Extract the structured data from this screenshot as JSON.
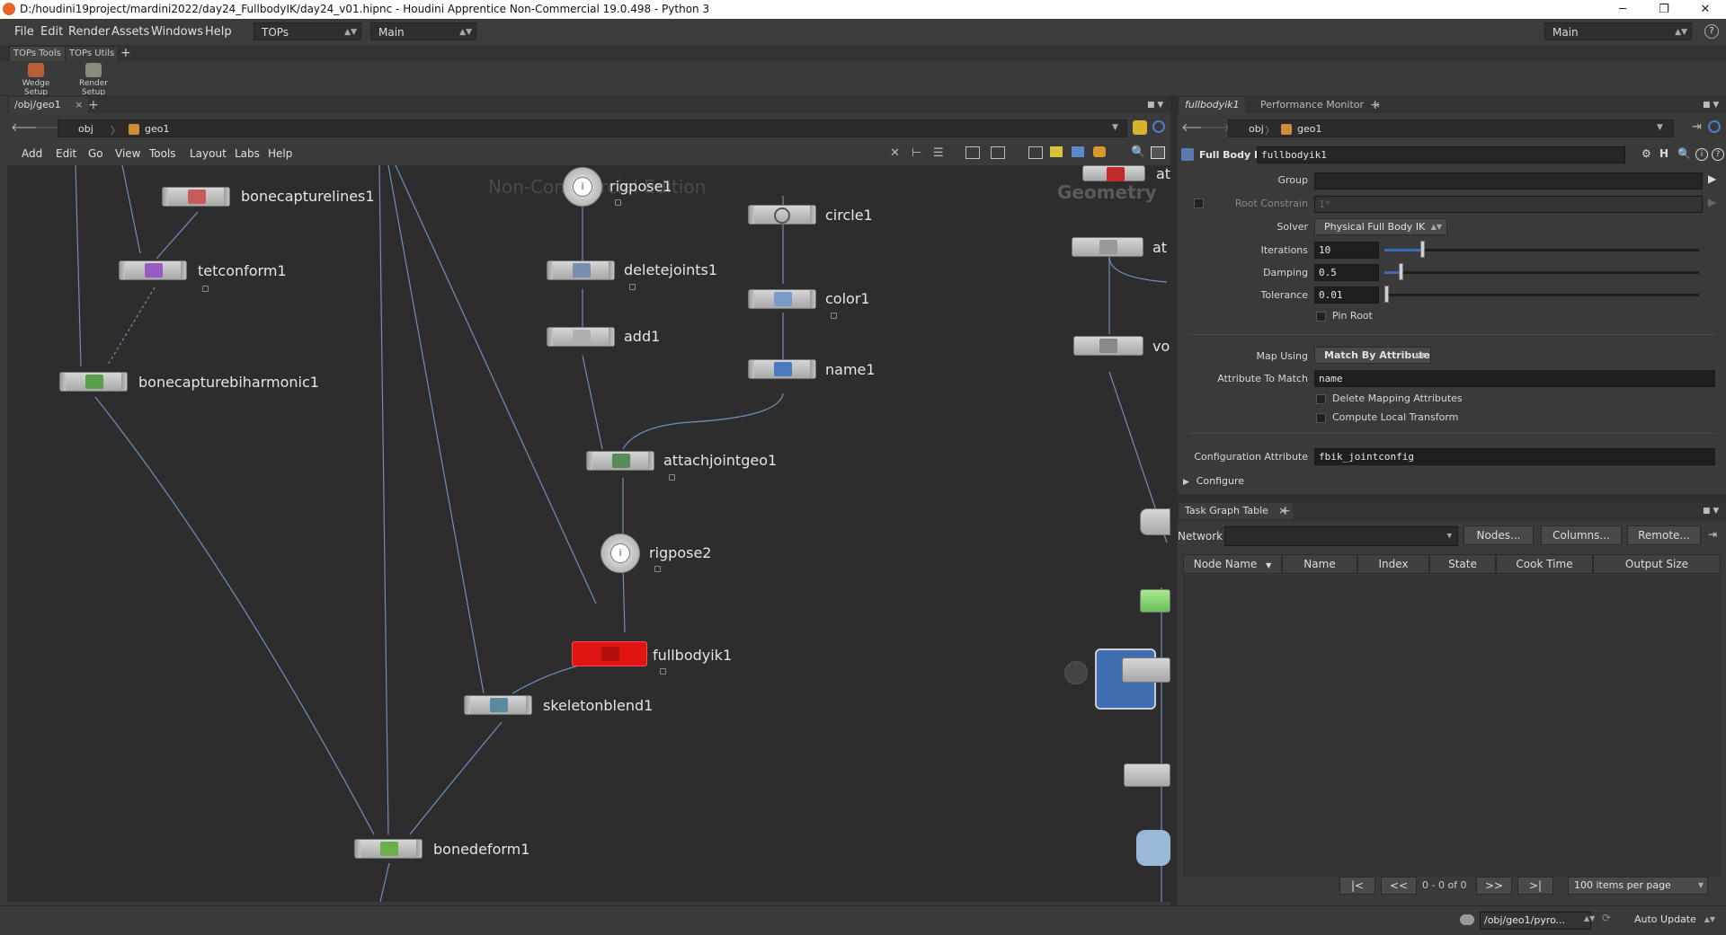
{
  "window": {
    "title": "D:/houdini19project/mardini2022/day24_FullbodyIK/day24_v01.hipnc - Houdini Apprentice Non-Commercial 19.0.498 - Python 3",
    "minimize": "─",
    "maximize": "❐",
    "close": "✕"
  },
  "menubar": {
    "items": [
      "File",
      "Edit",
      "Render",
      "Assets",
      "Windows",
      "Help"
    ],
    "desktop_select": "TOPs",
    "context_select": "Main",
    "right_select": "Main",
    "help_icon": "?"
  },
  "shelf": {
    "tabs": [
      "TOPs Tools",
      "TOPs Utils"
    ],
    "add": "+",
    "tools": [
      "Wedge Setup",
      "Render Setup"
    ]
  },
  "left_pane": {
    "tab": "/obj/geo1",
    "tab_close": "×",
    "add": "+",
    "path": [
      "obj",
      "geo1"
    ],
    "menu": [
      "Add",
      "Edit",
      "Go",
      "View",
      "Tools",
      "Layout",
      "Labs",
      "Help"
    ]
  },
  "network": {
    "watermark_left": "Non-Commercial Edition",
    "watermark_right": "Geometry",
    "nodes": [
      {
        "name": "bonecapturelines1"
      },
      {
        "name": "tetconform1"
      },
      {
        "name": "bonecapturebiharmonic1"
      },
      {
        "name": "rigpose1"
      },
      {
        "name": "deletejoints1"
      },
      {
        "name": "add1"
      },
      {
        "name": "circle1"
      },
      {
        "name": "color1"
      },
      {
        "name": "name1"
      },
      {
        "name": "attachjointgeo1"
      },
      {
        "name": "rigpose2"
      },
      {
        "name": "fullbodyik1"
      },
      {
        "name": "skeletonblend1"
      },
      {
        "name": "bonedeform1"
      }
    ],
    "partial_labels": [
      "at",
      "at",
      "vo"
    ]
  },
  "right_pane": {
    "tabs": [
      "fullbodyik1",
      "Performance Monitor"
    ],
    "tab_close": "×",
    "add": "+",
    "path": [
      "obj",
      "geo1"
    ],
    "node_type": "Full Body IK",
    "node_name": "fullbodyik1"
  },
  "params": {
    "group": {
      "label": "Group",
      "value": ""
    },
    "root_constrain": {
      "label": "Root Constrain",
      "value": "1*"
    },
    "solver": {
      "label": "Solver",
      "value": "Physical Full Body IK"
    },
    "iterations": {
      "label": "Iterations",
      "value": "10",
      "level": 0.12
    },
    "damping": {
      "label": "Damping",
      "value": "0.5",
      "level": 0.05
    },
    "tolerance": {
      "label": "Tolerance",
      "value": "0.01",
      "level": 0.0
    },
    "pin_root": "Pin Root",
    "map_using": {
      "label": "Map Using",
      "value": "Match By Attribute"
    },
    "attribute_to_match": {
      "label": "Attribute To Match",
      "value": "name"
    },
    "delete_mapping": "Delete Mapping Attributes",
    "compute_local": "Compute Local Transform",
    "config_attr": {
      "label": "Configuration Attribute",
      "value": "fbik_jointconfig"
    },
    "configure": "Configure"
  },
  "taskgraph": {
    "tab": "Task Graph Table",
    "tab_close": "×",
    "add": "+",
    "network_label": "Network",
    "network_value": "",
    "buttons": [
      "Nodes...",
      "Columns...",
      "Remote..."
    ],
    "columns": [
      "Node Name",
      "Name",
      "Index",
      "State",
      "Cook Time",
      "Output Size"
    ],
    "page_info": "0 - 0 of 0",
    "items_per_page": "100 items per page"
  },
  "statusbar": {
    "path": "/obj/geo1/pyro...",
    "update_mode": "Auto Update"
  }
}
